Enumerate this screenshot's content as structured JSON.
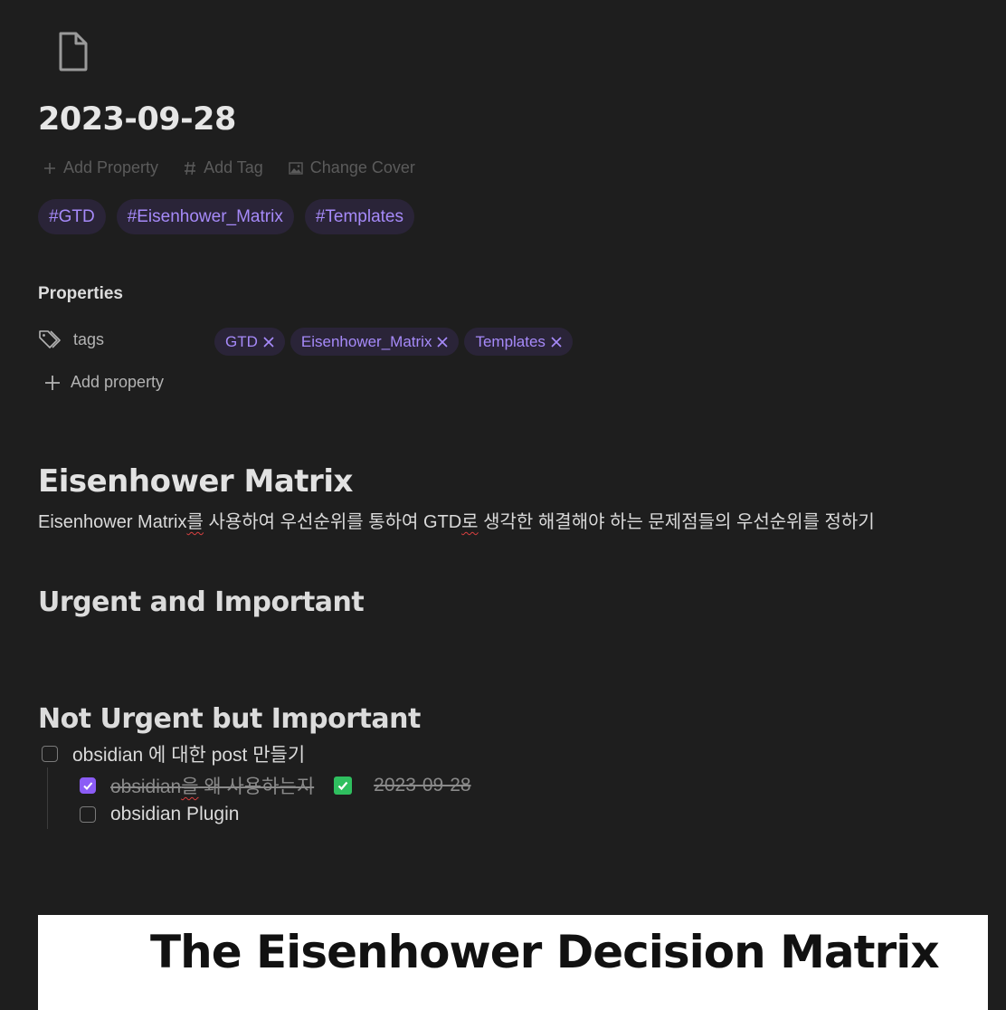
{
  "note": {
    "title": "2023-09-28",
    "icon": "file-icon"
  },
  "meta_actions": [
    {
      "label": "Add Property",
      "icon": "plus-icon"
    },
    {
      "label": "Add Tag",
      "icon": "hash-icon"
    },
    {
      "label": "Change Cover",
      "icon": "image-icon"
    }
  ],
  "tags": [
    "#GTD",
    "#Eisenhower_Matrix",
    "#Templates"
  ],
  "properties": {
    "heading": "Properties",
    "rows": [
      {
        "key": "tags",
        "icon": "tags-icon",
        "values": [
          "GTD",
          "Eisenhower_Matrix",
          "Templates"
        ]
      }
    ],
    "add_label": "Add property"
  },
  "content": {
    "h1": "Eisenhower Matrix",
    "intro": {
      "seg1": "Eisenhower Matrix",
      "seg2": "를",
      "seg3": " 사용하여 우선순위를 통하여 GTD",
      "seg4": "로",
      "seg5": " 생각한 해결해야 하는 문제점들의 우선순위를 정하기"
    },
    "sections": [
      {
        "title": "Urgent and Important"
      },
      {
        "title": "Not Urgent but Important"
      }
    ],
    "tasks": [
      {
        "text": "obsidian 에 대한 post 만들기",
        "checked": false
      },
      {
        "text_a": "obsidian",
        "text_b": "을",
        "text_c": " 왜 사용하는지",
        "done_date": "2023-09-28",
        "checked": true
      },
      {
        "text": "obsidian Plugin",
        "checked": false
      }
    ],
    "embed": {
      "title": "The Eisenhower Decision Matrix"
    }
  },
  "colors": {
    "background": "#1e1e1e",
    "accent": "#8b5cf6",
    "tag_text": "#a68af9",
    "tag_bg": "#2a2438"
  }
}
